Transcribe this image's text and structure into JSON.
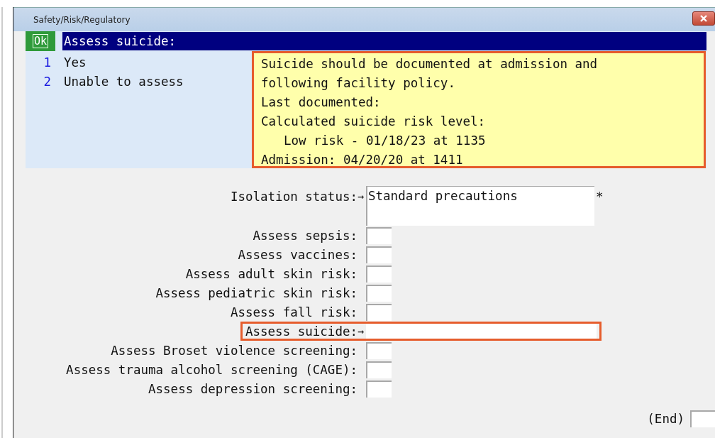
{
  "window": {
    "title": "Safety/Risk/Regulatory"
  },
  "prompt": {
    "ok": "Ok",
    "question": "Assess suicide:"
  },
  "options": [
    {
      "number": "1",
      "label": "Yes"
    },
    {
      "number": "2",
      "label": "Unable to assess"
    }
  ],
  "info": {
    "highlighted": true,
    "lines": [
      {
        "text": "Suicide should be documented at admission and",
        "indented": false
      },
      {
        "text": "following facility policy.",
        "indented": false
      },
      {
        "text": "Last documented:",
        "indented": false
      },
      {
        "text": "Calculated suicide risk level:",
        "indented": false
      },
      {
        "text": "Low risk - 01/18/23 at 1135",
        "indented": true
      },
      {
        "text": "Admission: 04/20/20 at 1411",
        "indented": false
      }
    ]
  },
  "fields": [
    {
      "label": "Isolation status:",
      "kind": "multiline",
      "pointer": "→",
      "value": "Standard precautions",
      "required_mark": "*",
      "highlighted": false
    },
    {
      "label": "Assess sepsis:",
      "kind": "short",
      "highlighted": false
    },
    {
      "label": "Assess vaccines:",
      "kind": "short",
      "highlighted": false
    },
    {
      "label": "Assess adult skin risk:",
      "kind": "short",
      "highlighted": false
    },
    {
      "label": "Assess pediatric skin risk:",
      "kind": "short",
      "highlighted": false
    },
    {
      "label": "Assess fall risk:",
      "kind": "short",
      "highlighted": false
    },
    {
      "label": "Assess suicide:",
      "kind": "wide",
      "pointer": "→",
      "highlighted": true
    },
    {
      "label": "Assess Broset violence screening:",
      "kind": "short",
      "highlighted": false
    },
    {
      "label": "Assess trauma alcohol screening (CAGE):",
      "kind": "short",
      "highlighted": false
    },
    {
      "label": "Assess depression screening:",
      "kind": "short",
      "highlighted": false
    }
  ],
  "end": {
    "label": "(End)"
  }
}
